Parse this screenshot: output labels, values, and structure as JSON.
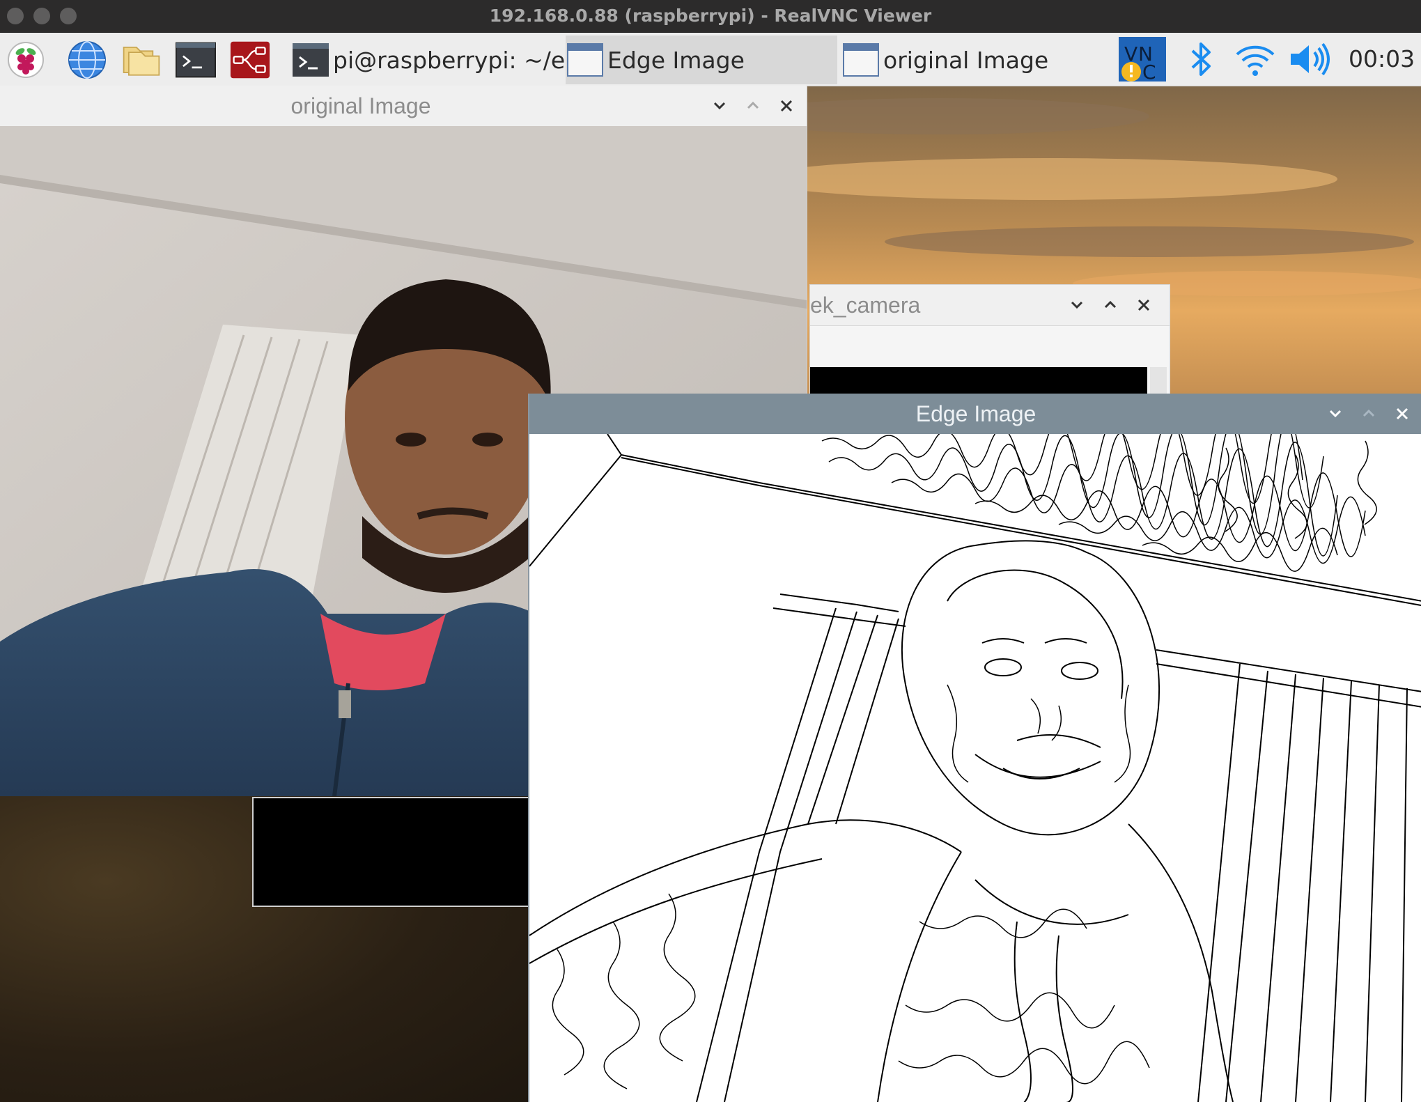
{
  "mac_window": {
    "title": "192.168.0.88 (raspberrypi) - RealVNC Viewer"
  },
  "panel": {
    "launchers": [
      {
        "name": "raspberry-menu-icon"
      },
      {
        "name": "web-browser-icon"
      },
      {
        "name": "file-manager-icon"
      },
      {
        "name": "terminal-icon"
      },
      {
        "name": "node-red-icon"
      }
    ],
    "tasks": [
      {
        "label": "pi@raspberrypi: ~/ec..."
      },
      {
        "label": "Edge Image"
      },
      {
        "label": "original Image"
      }
    ],
    "tray": [
      "vnc-server-icon",
      "bluetooth-icon",
      "wifi-icon",
      "volume-icon"
    ],
    "clock": "00:03"
  },
  "windows": {
    "original": {
      "title": "original Image"
    },
    "camera": {
      "title": "ek_camera"
    },
    "edge": {
      "title": "Edge Image"
    }
  },
  "colors": {
    "panel_bg": "#ededed",
    "focused_titlebar": "#7d8d98",
    "vnc_blue": "#1f64b8",
    "warning_yellow": "#f5b821",
    "tray_blue": "#1a8cf0"
  }
}
